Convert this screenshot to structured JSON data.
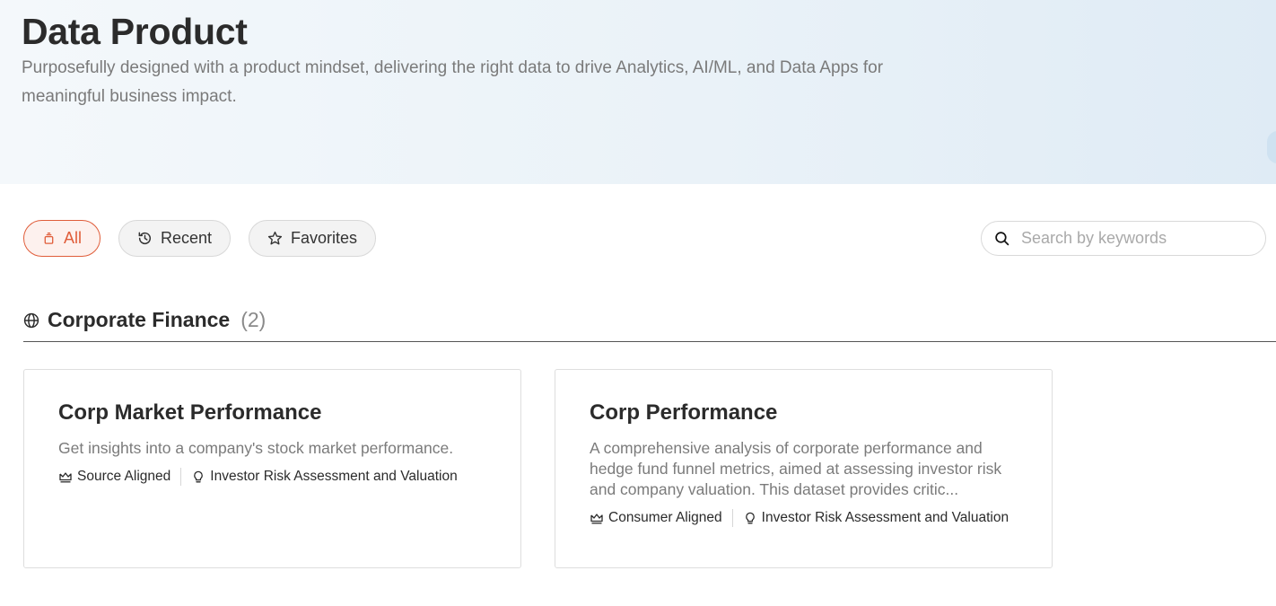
{
  "hero": {
    "title": "Data Product",
    "subtitle": "Purposefully designed with a product mindset, delivering the right data to drive Analytics, AI/ML, and Data Apps for meaningful business impact."
  },
  "filters": {
    "all_label": "All",
    "recent_label": "Recent",
    "favorites_label": "Favorites",
    "active": "All"
  },
  "search": {
    "placeholder": "Search by keywords",
    "value": ""
  },
  "section": {
    "title": "Corporate Finance",
    "count": "(2)"
  },
  "cards": [
    {
      "title": "Corp Market Performance",
      "description": "Get insights into a company's stock market performance.",
      "alignment": "Source Aligned",
      "use_case": "Investor Risk Assessment and Valuation"
    },
    {
      "title": "Corp Performance",
      "description": "A comprehensive analysis of corporate performance and hedge fund funnel metrics, aimed at assessing investor risk and company valuation. This dataset provides critic...",
      "alignment": "Consumer Aligned",
      "use_case": "Investor Risk Assessment and Valuation"
    }
  ],
  "colors": {
    "accent": "#e05d3a",
    "text": "#2b2b2b",
    "muted": "#7b7b7b",
    "hero_bg": "#eaf2f8"
  }
}
